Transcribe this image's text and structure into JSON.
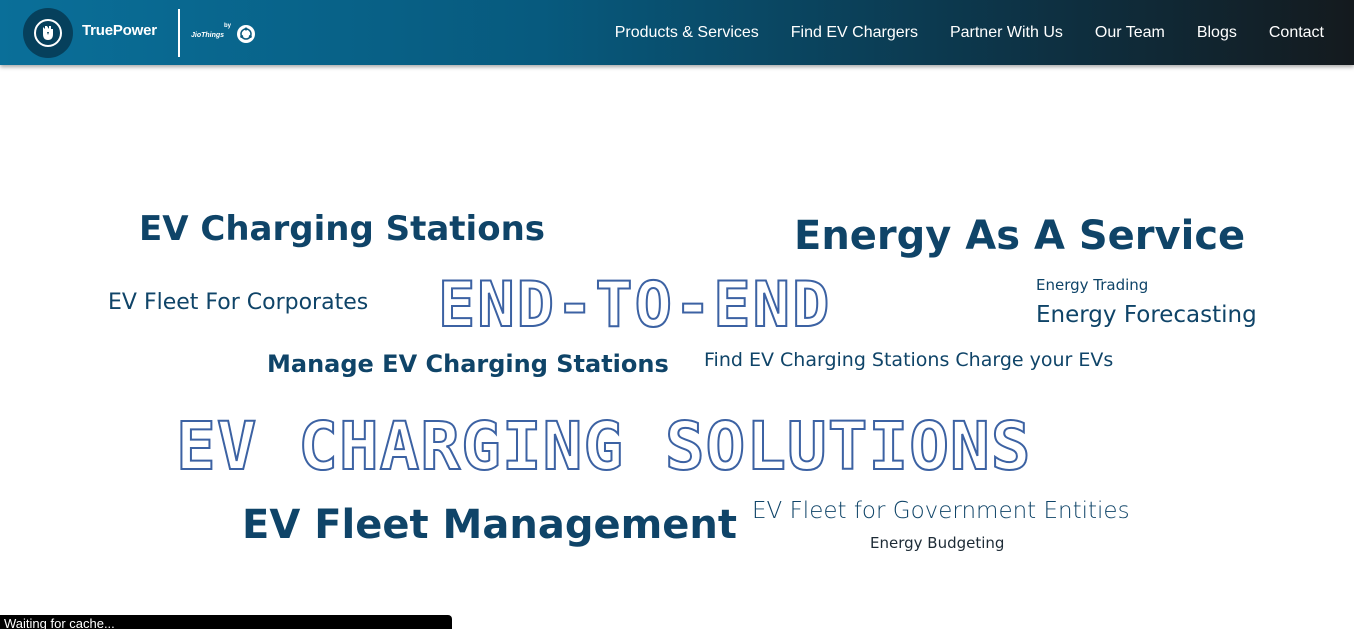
{
  "header": {
    "brand_name": "TruePower",
    "brand_by": "by",
    "brand_partner": "JioThings",
    "nav": [
      {
        "label": "Products & Services"
      },
      {
        "label": "Find EV Chargers"
      },
      {
        "label": "Partner With Us"
      },
      {
        "label": "Our Team"
      },
      {
        "label": "Blogs"
      },
      {
        "label": "Contact"
      }
    ]
  },
  "word_cloud": {
    "ev_charging_stations": "EV Charging Stations",
    "energy_as_a_service": "Energy As A Service",
    "ev_fleet_corporates": "EV Fleet For Corporates",
    "end_to_end": "END-TO-END",
    "energy_trading": "Energy Trading",
    "energy_forecasting": "Energy Forecasting",
    "manage_ev_charging": "Manage EV Charging Stations",
    "find_ev_charging": "Find EV Charging Stations Charge your EVs",
    "ev_charging_solutions": "EV CHARGING SOLUTIONS",
    "ev_fleet_management": "EV Fleet Management",
    "ev_fleet_government": "EV Fleet for Government Entities",
    "energy_budgeting": "Energy Budgeting"
  },
  "status": {
    "text": "Waiting for cache..."
  },
  "colors": {
    "primary_text": "#0f4468",
    "outline_stroke": "#3c62a3",
    "nav_gradient_start": "#0a6f99",
    "nav_gradient_end": "#141a1e"
  }
}
